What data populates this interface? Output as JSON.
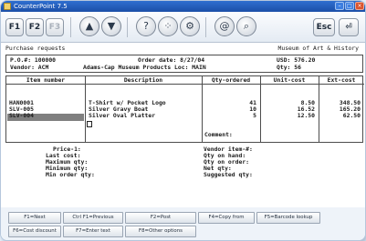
{
  "window": {
    "title": "CounterPoint 7.5"
  },
  "toolbar": {
    "f1_label": "F1",
    "f2_label": "F2",
    "f3_label": "F3",
    "esc_label": "Esc"
  },
  "header": {
    "left": "Purchase requests",
    "right": "Museum of Art & History"
  },
  "order": {
    "po_line": "P.O.#: 100000",
    "vendor_line": "Vendor: ACM",
    "date_line": "Order date: 8/27/04",
    "vendor_name_line": "Adams-Cap Museum Products Loc: MAIN",
    "usd_line": "USD: 576.20",
    "qty_line": "Qty: 56"
  },
  "grid": {
    "headers": [
      "Item number",
      "Description",
      "Qty-ordered",
      "Unit-cost",
      "Ext-cost"
    ],
    "rows": [
      {
        "item": "HAN0001",
        "desc": "T-Shirt w/ Pocket Logo",
        "qty": "41",
        "unit": "8.50",
        "ext": "348.50"
      },
      {
        "item": "SLV-005",
        "desc": "Silver Gravy Boat",
        "qty": "10",
        "unit": "16.52",
        "ext": "165.20"
      },
      {
        "item": "SLV-004",
        "desc": "Silver Oval Platter",
        "qty": "5",
        "unit": "12.50",
        "ext": "62.50"
      }
    ],
    "comment_label": "Comment:"
  },
  "details": {
    "left": [
      "Price-1:",
      "Last cost:",
      "Maximum qty:",
      "Minimum qty:",
      "Min order qty:"
    ],
    "right": [
      "Vendor item-#:",
      "Qty on hand:",
      "Qty on order:",
      "Net qty:",
      "Suggested qty:"
    ]
  },
  "fkeys": {
    "row1": [
      "F1=Next",
      "Ctrl F1=Previous",
      "F2=Post",
      "F4=Copy from",
      "F5=Barcode lookup"
    ],
    "row2": [
      "F6=Cost discount",
      "F7=Enter text",
      "F8=Other options"
    ]
  },
  "colors": {
    "titlebar": "#1b4fa8",
    "close": "#d9542f"
  }
}
